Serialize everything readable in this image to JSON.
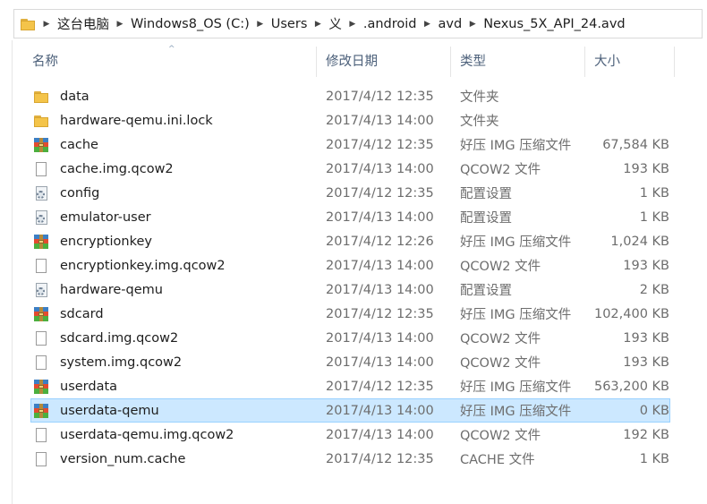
{
  "breadcrumbs": [
    "这台电脑",
    "Windows8_OS (C:)",
    "Users",
    "义",
    ".android",
    "avd",
    "Nexus_5X_API_24.avd"
  ],
  "columns": {
    "name": "名称",
    "date": "修改日期",
    "type": "类型",
    "size": "大小"
  },
  "files": [
    {
      "name": "data",
      "date": "2017/4/12 12:35",
      "type": "文件夹",
      "size": "",
      "icon": "folder-icon"
    },
    {
      "name": "hardware-qemu.ini.lock",
      "date": "2017/4/13 14:00",
      "type": "文件夹",
      "size": "",
      "icon": "folder-icon"
    },
    {
      "name": "cache",
      "date": "2017/4/12 12:35",
      "type": "好压 IMG 压缩文件",
      "size": "67,584 KB",
      "icon": "archive-icon"
    },
    {
      "name": "cache.img.qcow2",
      "date": "2017/4/13 14:00",
      "type": "QCOW2 文件",
      "size": "193 KB",
      "icon": "file-icon"
    },
    {
      "name": "config",
      "date": "2017/4/12 12:35",
      "type": "配置设置",
      "size": "1 KB",
      "icon": "config-file-icon"
    },
    {
      "name": "emulator-user",
      "date": "2017/4/13 14:00",
      "type": "配置设置",
      "size": "1 KB",
      "icon": "config-file-icon"
    },
    {
      "name": "encryptionkey",
      "date": "2017/4/12 12:26",
      "type": "好压 IMG 压缩文件",
      "size": "1,024 KB",
      "icon": "archive-icon"
    },
    {
      "name": "encryptionkey.img.qcow2",
      "date": "2017/4/13 14:00",
      "type": "QCOW2 文件",
      "size": "193 KB",
      "icon": "file-icon"
    },
    {
      "name": "hardware-qemu",
      "date": "2017/4/13 14:00",
      "type": "配置设置",
      "size": "2 KB",
      "icon": "config-file-icon"
    },
    {
      "name": "sdcard",
      "date": "2017/4/12 12:35",
      "type": "好压 IMG 压缩文件",
      "size": "102,400 KB",
      "icon": "archive-icon"
    },
    {
      "name": "sdcard.img.qcow2",
      "date": "2017/4/13 14:00",
      "type": "QCOW2 文件",
      "size": "193 KB",
      "icon": "file-icon"
    },
    {
      "name": "system.img.qcow2",
      "date": "2017/4/13 14:00",
      "type": "QCOW2 文件",
      "size": "193 KB",
      "icon": "file-icon"
    },
    {
      "name": "userdata",
      "date": "2017/4/12 12:35",
      "type": "好压 IMG 压缩文件",
      "size": "563,200 KB",
      "icon": "archive-icon"
    },
    {
      "name": "userdata-qemu",
      "date": "2017/4/13 14:00",
      "type": "好压 IMG 压缩文件",
      "size": "0 KB",
      "icon": "archive-icon",
      "selected": true
    },
    {
      "name": "userdata-qemu.img.qcow2",
      "date": "2017/4/13 14:00",
      "type": "QCOW2 文件",
      "size": "192 KB",
      "icon": "file-icon"
    },
    {
      "name": "version_num.cache",
      "date": "2017/4/12 12:35",
      "type": "CACHE 文件",
      "size": "1 KB",
      "icon": "file-icon"
    }
  ],
  "colors": {
    "selection_bg": "#cce8ff",
    "selection_border": "#99d1ff",
    "header_text": "#4c607a"
  }
}
